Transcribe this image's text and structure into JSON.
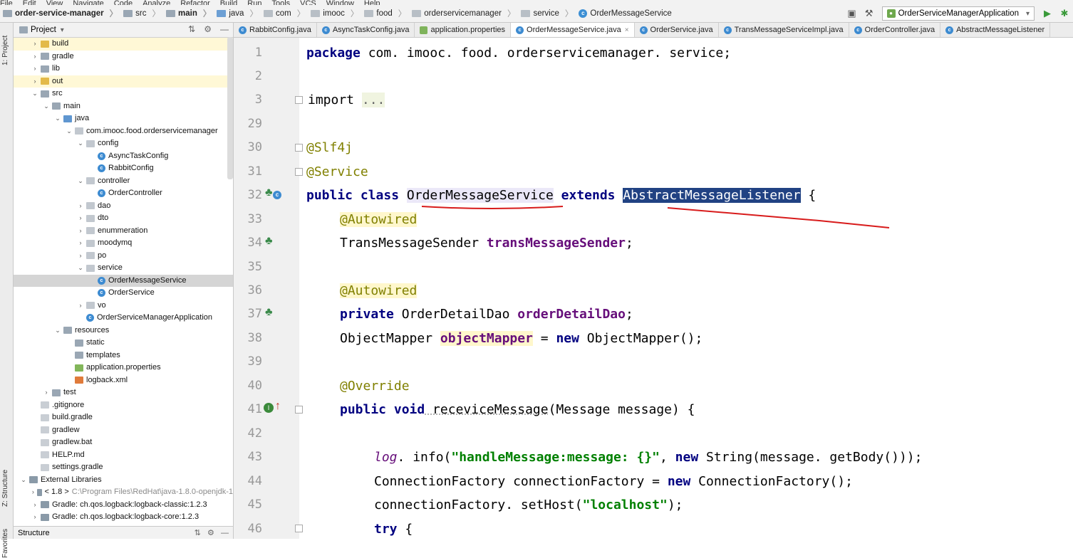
{
  "menubar": [
    "File",
    "Edit",
    "View",
    "Navigate",
    "Code",
    "Analyze",
    "Refactor",
    "Build",
    "Run",
    "Tools",
    "VCS",
    "Window",
    "Help"
  ],
  "breadcrumb": [
    "order-service-manager",
    "src",
    "main",
    "java",
    "com",
    "imooc",
    "food",
    "orderservicemanager",
    "service",
    "OrderMessageService"
  ],
  "run_config": "OrderServiceManagerApplication",
  "project_panel": {
    "title": "Project",
    "tree": [
      {
        "label": "build",
        "depth": 0,
        "caret": "›",
        "icon": "f-yellow",
        "hl": true
      },
      {
        "label": "gradle",
        "depth": 0,
        "caret": "›",
        "icon": "f-gray"
      },
      {
        "label": "lib",
        "depth": 0,
        "caret": "›",
        "icon": "f-gray"
      },
      {
        "label": "out",
        "depth": 0,
        "caret": "›",
        "icon": "f-yellow",
        "hl": true
      },
      {
        "label": "src",
        "depth": 0,
        "caret": "⌄",
        "icon": "f-gray"
      },
      {
        "label": "main",
        "depth": 1,
        "caret": "⌄",
        "icon": "f-gray"
      },
      {
        "label": "java",
        "depth": 2,
        "caret": "⌄",
        "icon": "f-blue"
      },
      {
        "label": "com.imooc.food.orderservicemanager",
        "depth": 3,
        "caret": "⌄",
        "icon": "f-pkg"
      },
      {
        "label": "config",
        "depth": 4,
        "caret": "⌄",
        "icon": "f-pkg"
      },
      {
        "label": "AsyncTaskConfig",
        "depth": 5,
        "caret": "",
        "icon": "class"
      },
      {
        "label": "RabbitConfig",
        "depth": 5,
        "caret": "",
        "icon": "class"
      },
      {
        "label": "controller",
        "depth": 4,
        "caret": "⌄",
        "icon": "f-pkg"
      },
      {
        "label": "OrderController",
        "depth": 5,
        "caret": "",
        "icon": "class"
      },
      {
        "label": "dao",
        "depth": 4,
        "caret": "›",
        "icon": "f-pkg"
      },
      {
        "label": "dto",
        "depth": 4,
        "caret": "›",
        "icon": "f-pkg"
      },
      {
        "label": "enummeration",
        "depth": 4,
        "caret": "›",
        "icon": "f-pkg"
      },
      {
        "label": "moodymq",
        "depth": 4,
        "caret": "›",
        "icon": "f-pkg"
      },
      {
        "label": "po",
        "depth": 4,
        "caret": "›",
        "icon": "f-pkg"
      },
      {
        "label": "service",
        "depth": 4,
        "caret": "⌄",
        "icon": "f-pkg"
      },
      {
        "label": "OrderMessageService",
        "depth": 5,
        "caret": "",
        "icon": "class",
        "sel": true
      },
      {
        "label": "OrderService",
        "depth": 5,
        "caret": "",
        "icon": "class"
      },
      {
        "label": "vo",
        "depth": 4,
        "caret": "›",
        "icon": "f-pkg"
      },
      {
        "label": "OrderServiceManagerApplication",
        "depth": 4,
        "caret": "",
        "icon": "class"
      },
      {
        "label": "resources",
        "depth": 2,
        "caret": "⌄",
        "icon": "f-gray"
      },
      {
        "label": "static",
        "depth": 3,
        "caret": "",
        "icon": "f-gray"
      },
      {
        "label": "templates",
        "depth": 3,
        "caret": "",
        "icon": "f-gray"
      },
      {
        "label": "application.properties",
        "depth": 3,
        "caret": "",
        "icon": "f-leaf"
      },
      {
        "label": "logback.xml",
        "depth": 3,
        "caret": "",
        "icon": "f-xml"
      },
      {
        "label": "test",
        "depth": 1,
        "caret": "›",
        "icon": "f-gray"
      },
      {
        "label": ".gitignore",
        "depth": 0,
        "caret": "",
        "icon": "f-file"
      },
      {
        "label": "build.gradle",
        "depth": 0,
        "caret": "",
        "icon": "f-file"
      },
      {
        "label": "gradlew",
        "depth": 0,
        "caret": "",
        "icon": "f-file"
      },
      {
        "label": "gradlew.bat",
        "depth": 0,
        "caret": "",
        "icon": "f-file"
      },
      {
        "label": "HELP.md",
        "depth": 0,
        "caret": "",
        "icon": "f-file"
      },
      {
        "label": "settings.gradle",
        "depth": 0,
        "caret": "",
        "icon": "f-file"
      },
      {
        "label": "External Libraries",
        "depth": -1,
        "caret": "⌄",
        "icon": "f-lib"
      },
      {
        "label": "< 1.8 >",
        "muted": "C:\\Program Files\\RedHat\\java-1.8.0-openjdk-1",
        "depth": 0,
        "caret": "›",
        "icon": "f-lib"
      },
      {
        "label": "Gradle: ch.qos.logback:logback-classic:1.2.3",
        "depth": 0,
        "caret": "›",
        "icon": "f-lib"
      },
      {
        "label": "Gradle: ch.qos.logback:logback-core:1.2.3",
        "depth": 0,
        "caret": "›",
        "icon": "f-lib"
      }
    ]
  },
  "structure_bar": "Structure",
  "side_tabs": {
    "project": "1: Project",
    "structure": "Z: Structure",
    "favorites": "Favorites"
  },
  "editor_tabs": [
    {
      "label": "RabbitConfig.java",
      "icon": "class"
    },
    {
      "label": "AsyncTaskConfig.java",
      "icon": "class"
    },
    {
      "label": "application.properties",
      "icon": "leaf"
    },
    {
      "label": "OrderMessageService.java",
      "icon": "class",
      "active": true
    },
    {
      "label": "OrderService.java",
      "icon": "class"
    },
    {
      "label": "TransMessageServiceImpl.java",
      "icon": "class"
    },
    {
      "label": "OrderController.java",
      "icon": "class"
    },
    {
      "label": "AbstractMessageListener",
      "icon": "class"
    }
  ],
  "code": {
    "line_numbers": [
      "1",
      "2",
      "3",
      "29",
      "30",
      "31",
      "32",
      "33",
      "34",
      "35",
      "36",
      "37",
      "38",
      "39",
      "40",
      "41",
      "42",
      "43",
      "44",
      "45",
      "46"
    ],
    "pkg_kw": "package",
    "pkg_name": " com. imooc. food. orderservicemanager. service;",
    "import_kw": "import",
    "import_dots": "...",
    "slf4j": "@Slf4j",
    "service": "@Service",
    "cls_public": "public class",
    "cls_name": "OrderMessageService",
    "cls_extends": "extends",
    "cls_parent": "AbstractMessageListener",
    "cls_brace": " {",
    "autowired1": "@Autowired",
    "l34_type": "TransMessageSender ",
    "l34_field": "transMessageSender",
    "l34_end": ";",
    "autowired2": "@Autowired",
    "l37_kw": "private",
    "l37_type": " OrderDetailDao ",
    "l37_field": "orderDetailDao",
    "l37_end": ";",
    "l38_type": "ObjectMapper ",
    "l38_field": "objectMapper",
    "l38_eq": " = ",
    "l38_new": "new",
    "l38_rest": " ObjectMapper();",
    "override": "@Override",
    "l41_kw": "public void",
    "l41_method": " receviceMessage",
    "l41_rest": "(Message message) {",
    "l43_log": "log",
    "l43_mid": ". info(",
    "l43_str": "\"handleMessage:message: {}\"",
    "l43_comma": ", ",
    "l43_new": "new",
    "l43_rest": " String(message. getBody()));",
    "l44_a": "ConnectionFactory connectionFactory = ",
    "l44_new": "new",
    "l44_b": " ConnectionFactory();",
    "l45_a": "connectionFactory. setHost(",
    "l45_str": "\"localhost\"",
    "l45_b": ");",
    "l46_kw": "try",
    "l46_b": " {"
  },
  "colors": {
    "annotation_red": "#d81b1b",
    "selection": "#214283"
  }
}
